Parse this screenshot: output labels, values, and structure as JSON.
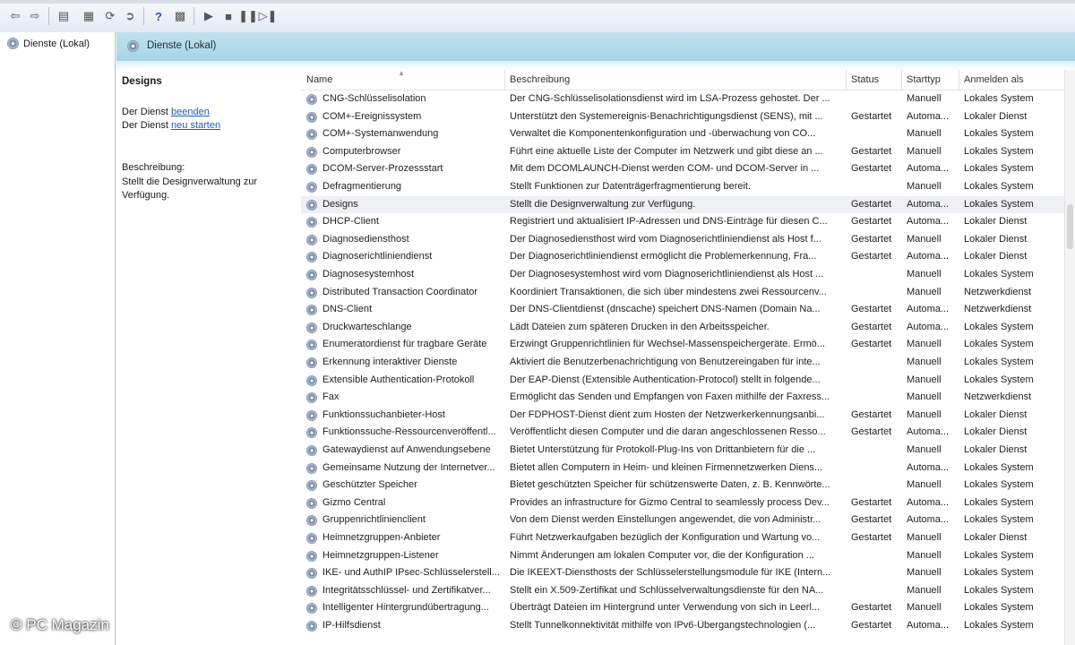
{
  "tree": {
    "root_label": "Dienste (Lokal)"
  },
  "main_header": {
    "title": "Dienste (Lokal)"
  },
  "description_pane": {
    "heading": "Designs",
    "stop_prefix": "Der Dienst ",
    "stop_link": "beenden",
    "restart_prefix": "Der Dienst ",
    "restart_link": "neu starten",
    "desc_label": "Beschreibung:",
    "desc_text": "Stellt die Designverwaltung zur Verfügung."
  },
  "columns": {
    "name": "Name",
    "desc": "Beschreibung",
    "status": "Status",
    "start": "Starttyp",
    "logon": "Anmelden als"
  },
  "services": [
    {
      "name": "CNG-Schlüsselisolation",
      "desc": "Der CNG-Schlüsselisolationsdienst wird im LSA-Prozess gehostet. Der ...",
      "status": "",
      "start": "Manuell",
      "logon": "Lokales System"
    },
    {
      "name": "COM+-Ereignissystem",
      "desc": "Unterstützt den Systemereignis-Benachrichtigungsdienst (SENS), mit ...",
      "status": "Gestartet",
      "start": "Automa...",
      "logon": "Lokaler Dienst"
    },
    {
      "name": "COM+-Systemanwendung",
      "desc": "Verwaltet die Komponentenkonfiguration und -überwachung von CO...",
      "status": "",
      "start": "Manuell",
      "logon": "Lokales System"
    },
    {
      "name": "Computerbrowser",
      "desc": "Führt eine aktuelle Liste der Computer im Netzwerk und gibt diese an ...",
      "status": "Gestartet",
      "start": "Manuell",
      "logon": "Lokales System"
    },
    {
      "name": "DCOM-Server-Prozessstart",
      "desc": "Mit dem DCOMLAUNCH-Dienst werden COM- und DCOM-Server in ...",
      "status": "Gestartet",
      "start": "Automa...",
      "logon": "Lokales System"
    },
    {
      "name": "Defragmentierung",
      "desc": "Stellt Funktionen zur Datenträgerfragmentierung bereit.",
      "status": "",
      "start": "Manuell",
      "logon": "Lokales System"
    },
    {
      "name": "Designs",
      "desc": "Stellt die Designverwaltung zur Verfügung.",
      "status": "Gestartet",
      "start": "Automa...",
      "logon": "Lokales System",
      "selected": true
    },
    {
      "name": "DHCP-Client",
      "desc": "Registriert und aktualisiert IP-Adressen und DNS-Einträge für diesen C...",
      "status": "Gestartet",
      "start": "Automa...",
      "logon": "Lokaler Dienst"
    },
    {
      "name": "Diagnosediensthost",
      "desc": "Der Diagnosediensthost wird vom Diagnoserichtliniendienst als Host f...",
      "status": "Gestartet",
      "start": "Manuell",
      "logon": "Lokaler Dienst"
    },
    {
      "name": "Diagnoserichtliniendienst",
      "desc": "Der Diagnoserichtliniendienst ermöglicht die Problemerkennung, Fra...",
      "status": "Gestartet",
      "start": "Automa...",
      "logon": "Lokaler Dienst"
    },
    {
      "name": "Diagnosesystemhost",
      "desc": "Der Diagnosesystemhost wird vom Diagnoserichtliniendienst als Host ...",
      "status": "",
      "start": "Manuell",
      "logon": "Lokales System"
    },
    {
      "name": "Distributed Transaction Coordinator",
      "desc": "Koordiniert Transaktionen, die sich über mindestens zwei Ressourcenv...",
      "status": "",
      "start": "Manuell",
      "logon": "Netzwerkdienst"
    },
    {
      "name": "DNS-Client",
      "desc": "Der DNS-Clientdienst (dnscache) speichert DNS-Namen (Domain Na...",
      "status": "Gestartet",
      "start": "Automa...",
      "logon": "Netzwerkdienst"
    },
    {
      "name": "Druckwarteschlange",
      "desc": "Lädt Dateien zum späteren Drucken in den Arbeitsspeicher.",
      "status": "Gestartet",
      "start": "Automa...",
      "logon": "Lokales System"
    },
    {
      "name": "Enumeratordienst für tragbare Geräte",
      "desc": "Erzwingt Gruppenrichtlinien für Wechsel-Massenspeichergeräte. Ermö...",
      "status": "Gestartet",
      "start": "Manuell",
      "logon": "Lokales System"
    },
    {
      "name": "Erkennung interaktiver Dienste",
      "desc": "Aktiviert die Benutzerbenachrichtigung von Benutzereingaben für inte...",
      "status": "",
      "start": "Manuell",
      "logon": "Lokales System"
    },
    {
      "name": "Extensible Authentication-Protokoll",
      "desc": "Der EAP-Dienst (Extensible Authentication-Protocol) stellt in folgende...",
      "status": "",
      "start": "Manuell",
      "logon": "Lokales System"
    },
    {
      "name": "Fax",
      "desc": "Ermöglicht das Senden und Empfangen von Faxen mithilfe der Faxress...",
      "status": "",
      "start": "Manuell",
      "logon": "Netzwerkdienst"
    },
    {
      "name": "Funktionssuchanbieter-Host",
      "desc": "Der FDPHOST-Dienst dient zum Hosten der Netzwerkerkennungsanbi...",
      "status": "Gestartet",
      "start": "Manuell",
      "logon": "Lokaler Dienst"
    },
    {
      "name": "Funktionssuche-Ressourcenveröffentl...",
      "desc": "Veröffentlicht diesen Computer und die daran angeschlossenen Resso...",
      "status": "Gestartet",
      "start": "Automa...",
      "logon": "Lokaler Dienst"
    },
    {
      "name": "Gatewaydienst auf Anwendungsebene",
      "desc": "Bietet Unterstützung für Protokoll-Plug-Ins von Drittanbietern für die ...",
      "status": "",
      "start": "Manuell",
      "logon": "Lokaler Dienst"
    },
    {
      "name": "Gemeinsame Nutzung der Internetver...",
      "desc": "Bietet allen Computern in Heim- und kleinen Firmennetzwerken Diens...",
      "status": "",
      "start": "Automa...",
      "logon": "Lokales System"
    },
    {
      "name": "Geschützter Speicher",
      "desc": "Bietet geschützten Speicher für schützenswerte Daten, z. B. Kennwörte...",
      "status": "",
      "start": "Manuell",
      "logon": "Lokales System"
    },
    {
      "name": "Gizmo Central",
      "desc": "Provides an infrastructure for Gizmo Central to seamlessly process Dev...",
      "status": "Gestartet",
      "start": "Automa...",
      "logon": "Lokales System"
    },
    {
      "name": "Gruppenrichtlinienclient",
      "desc": "Von dem Dienst werden Einstellungen angewendet, die von Administr...",
      "status": "Gestartet",
      "start": "Automa...",
      "logon": "Lokales System"
    },
    {
      "name": "Heimnetzgruppen-Anbieter",
      "desc": "Führt Netzwerkaufgaben bezüglich der Konfiguration und Wartung vo...",
      "status": "Gestartet",
      "start": "Manuell",
      "logon": "Lokaler Dienst"
    },
    {
      "name": "Heimnetzgruppen-Listener",
      "desc": "Nimmt Änderungen am lokalen Computer vor, die der Konfiguration ...",
      "status": "",
      "start": "Manuell",
      "logon": "Lokales System"
    },
    {
      "name": "IKE- und AuthIP IPsec-Schlüsselerstell...",
      "desc": "Die IKEEXT-Diensthosts der Schlüsselerstellungsmodule für IKE (Intern...",
      "status": "",
      "start": "Manuell",
      "logon": "Lokales System"
    },
    {
      "name": "Integritätsschlüssel- und Zertifikatver...",
      "desc": "Stellt ein X.509-Zertifikat und Schlüsselverwaltungsdienste für den NA...",
      "status": "",
      "start": "Manuell",
      "logon": "Lokales System"
    },
    {
      "name": "Intelligenter Hintergrundübertragung...",
      "desc": "Überträgt Dateien im Hintergrund unter Verwendung von sich in Leerl...",
      "status": "Gestartet",
      "start": "Manuell",
      "logon": "Lokales System"
    },
    {
      "name": "IP-Hilfsdienst",
      "desc": "Stellt Tunnelkonnektivität mithilfe von IPv6-Übergangstechnologien (...",
      "status": "Gestartet",
      "start": "Automa...",
      "logon": "Lokales System"
    }
  ],
  "watermark": "© PC Magazin",
  "colors": {
    "header_blue": "#b4dcec",
    "link": "#1a5fb4",
    "selected_row": "#eef0f3"
  }
}
